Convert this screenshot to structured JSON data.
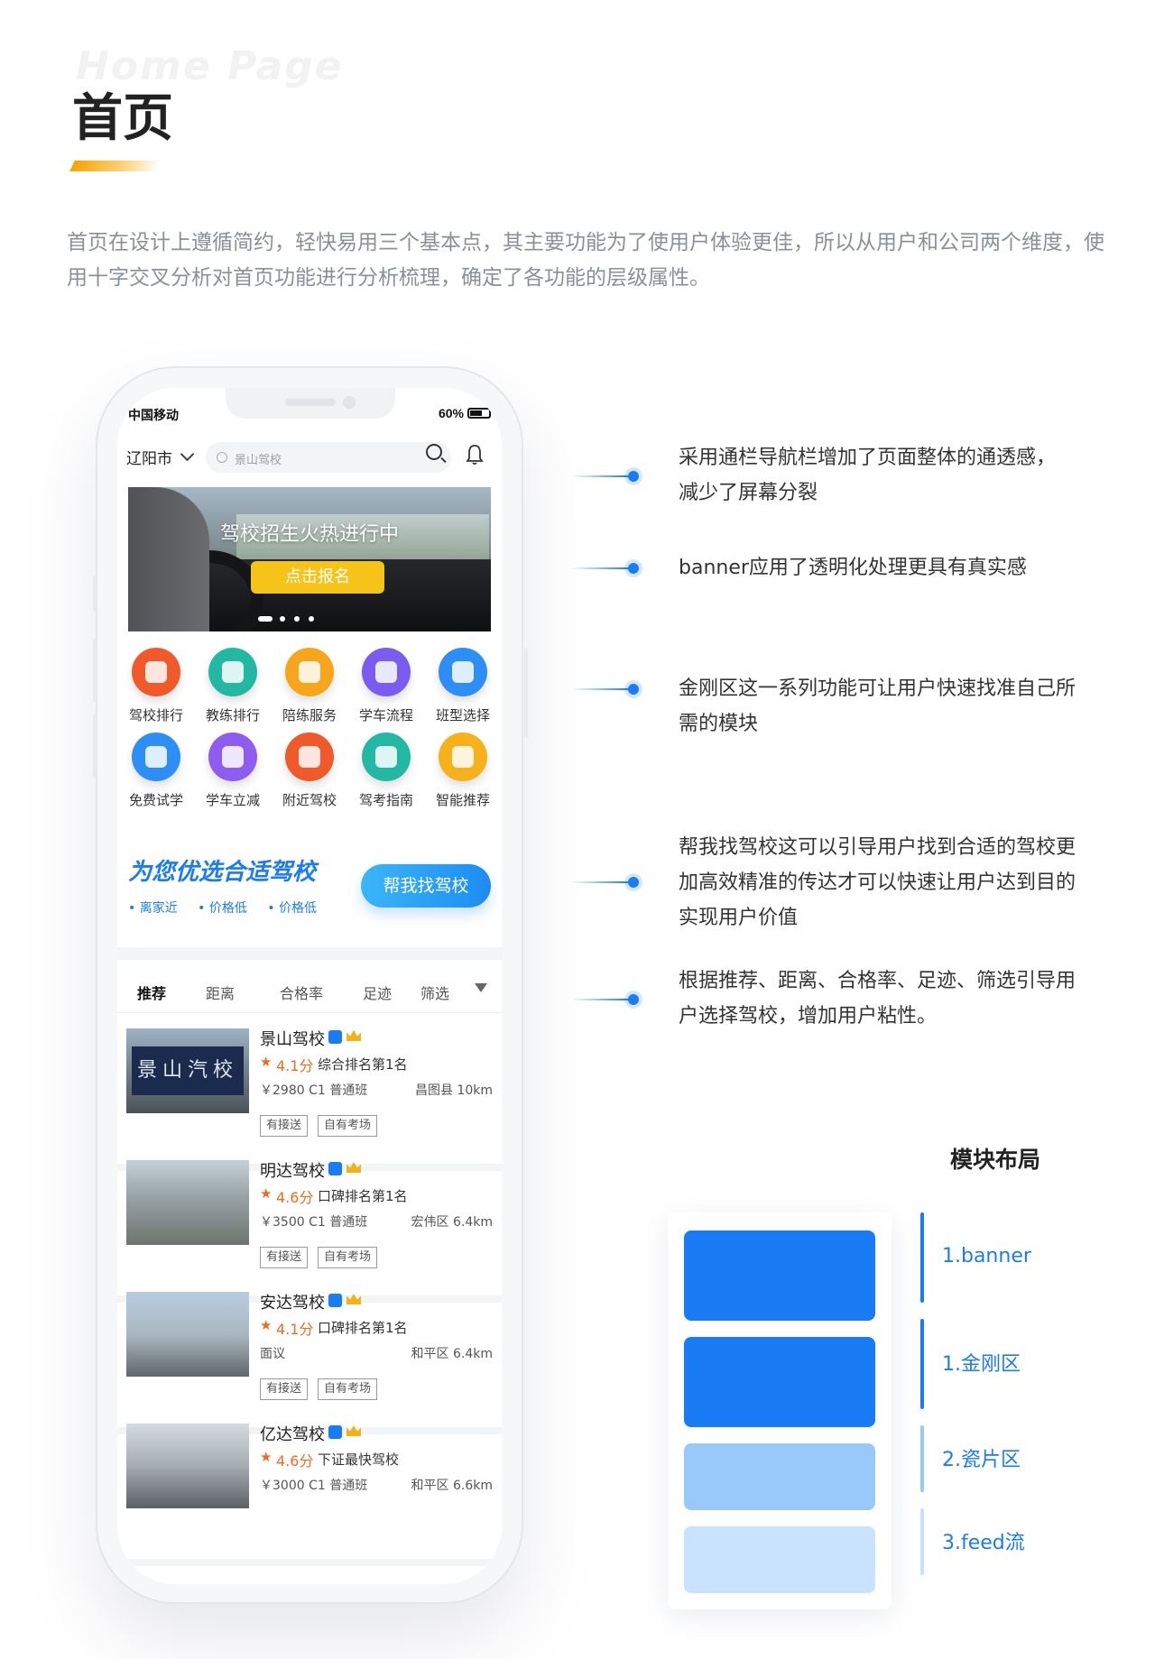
{
  "header": {
    "ghost_title": "Home Page",
    "title": "首页",
    "intro": "首页在设计上遵循简约，轻快易用三个基本点，其主要功能为了使用户体验更佳，所以从用户和公司两个维度，使用十字交叉分析对首页功能进行分析梳理，确定了各功能的层级属性。"
  },
  "phone": {
    "status": {
      "carrier": "中国移动",
      "battery": "60%"
    },
    "nav": {
      "city": "辽阳市",
      "search_placeholder": "景山驾校"
    },
    "banner": {
      "title": "驾校招生火热进行中",
      "button": "点击报名"
    },
    "grid": [
      {
        "label": "驾校排行",
        "color": "#f05a2a",
        "icon": "trophy-icon"
      },
      {
        "label": "教练排行",
        "color": "#23b8a4",
        "icon": "medal-icon"
      },
      {
        "label": "陪练服务",
        "color": "#f7a51a",
        "icon": "person-icon"
      },
      {
        "label": "学车流程",
        "color": "#7a5cf0",
        "icon": "flow-icon"
      },
      {
        "label": "班型选择",
        "color": "#2d8ef5",
        "icon": "book-icon"
      },
      {
        "label": "免费试学",
        "color": "#2d8ef5",
        "icon": "free-icon"
      },
      {
        "label": "学车立减",
        "color": "#8f5cf0",
        "icon": "discount-icon"
      },
      {
        "label": "附近驾校",
        "color": "#f05a2a",
        "icon": "people-icon"
      },
      {
        "label": "驾考指南",
        "color": "#23b8a4",
        "icon": "guide-icon"
      },
      {
        "label": "智能推荐",
        "color": "#f7b11a",
        "icon": "robot-icon"
      }
    ],
    "promo": {
      "title": "为您优选合适驾校",
      "tags": [
        "离家近",
        "价格低",
        "价格低"
      ],
      "button": "帮我找驾校"
    },
    "tabs": [
      "推荐",
      "距离",
      "合格率",
      "足迹",
      "筛选"
    ],
    "schools": [
      {
        "name": "景山驾校",
        "sign": "景山汽校",
        "score": "4.1分",
        "rank": "综合排名第1名",
        "price": "￥2980 C1 普通班",
        "location": "昌图县 10km",
        "badges": [
          "有接送",
          "自有考场"
        ]
      },
      {
        "name": "明达驾校",
        "sign": "",
        "score": "4.6分",
        "rank": "口碑排名第1名",
        "price": "￥3500 C1 普通班",
        "location": "宏伟区 6.4km",
        "badges": [
          "有接送",
          "自有考场"
        ]
      },
      {
        "name": "安达驾校",
        "sign": "",
        "score": "4.1分",
        "rank": "口碑排名第1名",
        "price": "面议",
        "location": "和平区 6.4km",
        "badges": [
          "有接送",
          "自有考场"
        ]
      },
      {
        "name": "亿达驾校",
        "sign": "",
        "score": "4.6分",
        "rank": "下证最快驾校",
        "price": "￥3000 C1 普通班",
        "location": "和平区 6.6km",
        "badges": []
      }
    ]
  },
  "annotations": [
    {
      "text": "采用通栏导航栏增加了页面整体的通透感，减少了屏幕分裂"
    },
    {
      "text": "banner应用了透明化处理更具有真实感"
    },
    {
      "text": "金刚区这一系列功能可让用户快速找准自己所需的模块"
    },
    {
      "text": "帮我找驾校这可以引导用户找到合适的驾校更加高效精准的传达才可以快速让用户达到目的实现用户价值"
    },
    {
      "text": "根据推荐、距离、合格率、足迹、筛选引导用户选择驾校，增加用户粘性。"
    }
  ],
  "layout": {
    "title": "模块布局",
    "modules": [
      {
        "label": "1.banner",
        "color": "#1a7cf5"
      },
      {
        "label": "1.金刚区",
        "color": "#1a7cf5"
      },
      {
        "label": "2.瓷片区",
        "color": "#99c8fb"
      },
      {
        "label": "3.feed流",
        "color": "#c9e2fd"
      }
    ]
  }
}
